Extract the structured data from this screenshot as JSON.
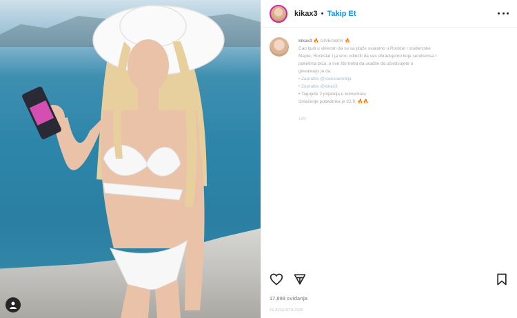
{
  "post": {
    "username": "kikax3",
    "separator": "•",
    "follow_label": "Takip Et",
    "caption_username": "kikax3",
    "caption_lines": [
      "🔥 GIVEAWAY 🔥",
      "Cao ljudi u vikerom da se sa plaže svaramo u Rockter i studentske",
      "Maple, Rockstar i ja smo odlučili da vas obradujemo koje sendsimsa i",
      "paketima pića, a sve što treba da uradite da učestvujete u",
      "giveaways je da:",
      "• Zapratite @rockstarsrbija",
      "• Zapratite @kikax3",
      "• Tagujete 2 prijatelja u komentaru",
      "Izvlačenje pobednika je 22.9. 🔥🔥"
    ],
    "caption_time": "14h",
    "likes": "17,898 sviđanja",
    "date": "22 AVGUSTA 2020"
  },
  "icons": {
    "like": "heart-icon",
    "share": "send-icon",
    "save": "bookmark-icon",
    "more": "more-options-icon",
    "tagged_user": "user-tag-icon"
  },
  "colors": {
    "link": "#0095f6",
    "story_ring": "#d6249f",
    "sea": "#2c86aa"
  }
}
